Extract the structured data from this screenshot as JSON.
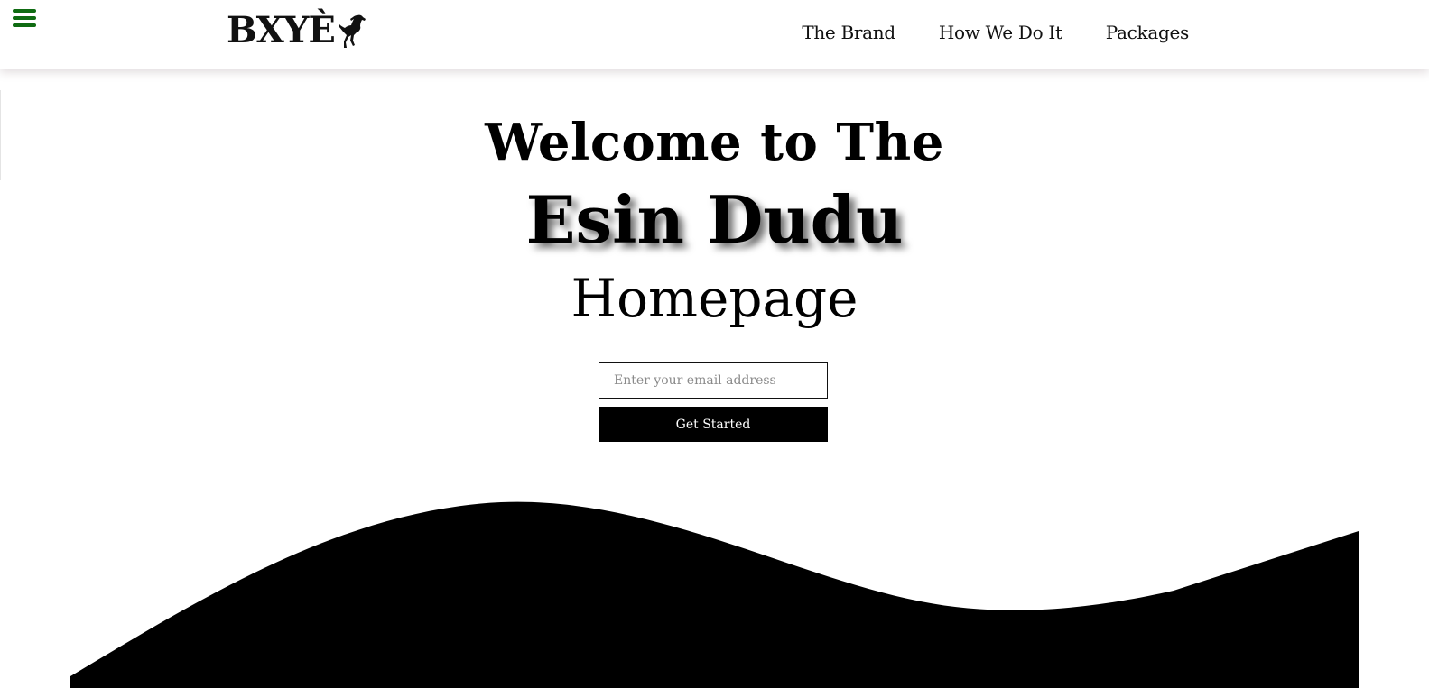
{
  "header": {
    "menu_icon": "hamburger-icon",
    "logo_text": "BXYÈ",
    "logo_icon": "rearing-horse-icon",
    "nav": [
      {
        "label": "The Brand"
      },
      {
        "label": "How We Do It"
      },
      {
        "label": "Packages"
      }
    ]
  },
  "hero": {
    "line1": "Welcome to The",
    "line2": "Esin Dudu",
    "line3": "Homepage"
  },
  "signup": {
    "email_placeholder": "Enter your email address",
    "email_value": "",
    "button_label": "Get Started"
  },
  "colors": {
    "menu_icon": "#0f6b12",
    "wave": "#000000",
    "button_bg": "#000000",
    "button_text": "#ffffff"
  }
}
